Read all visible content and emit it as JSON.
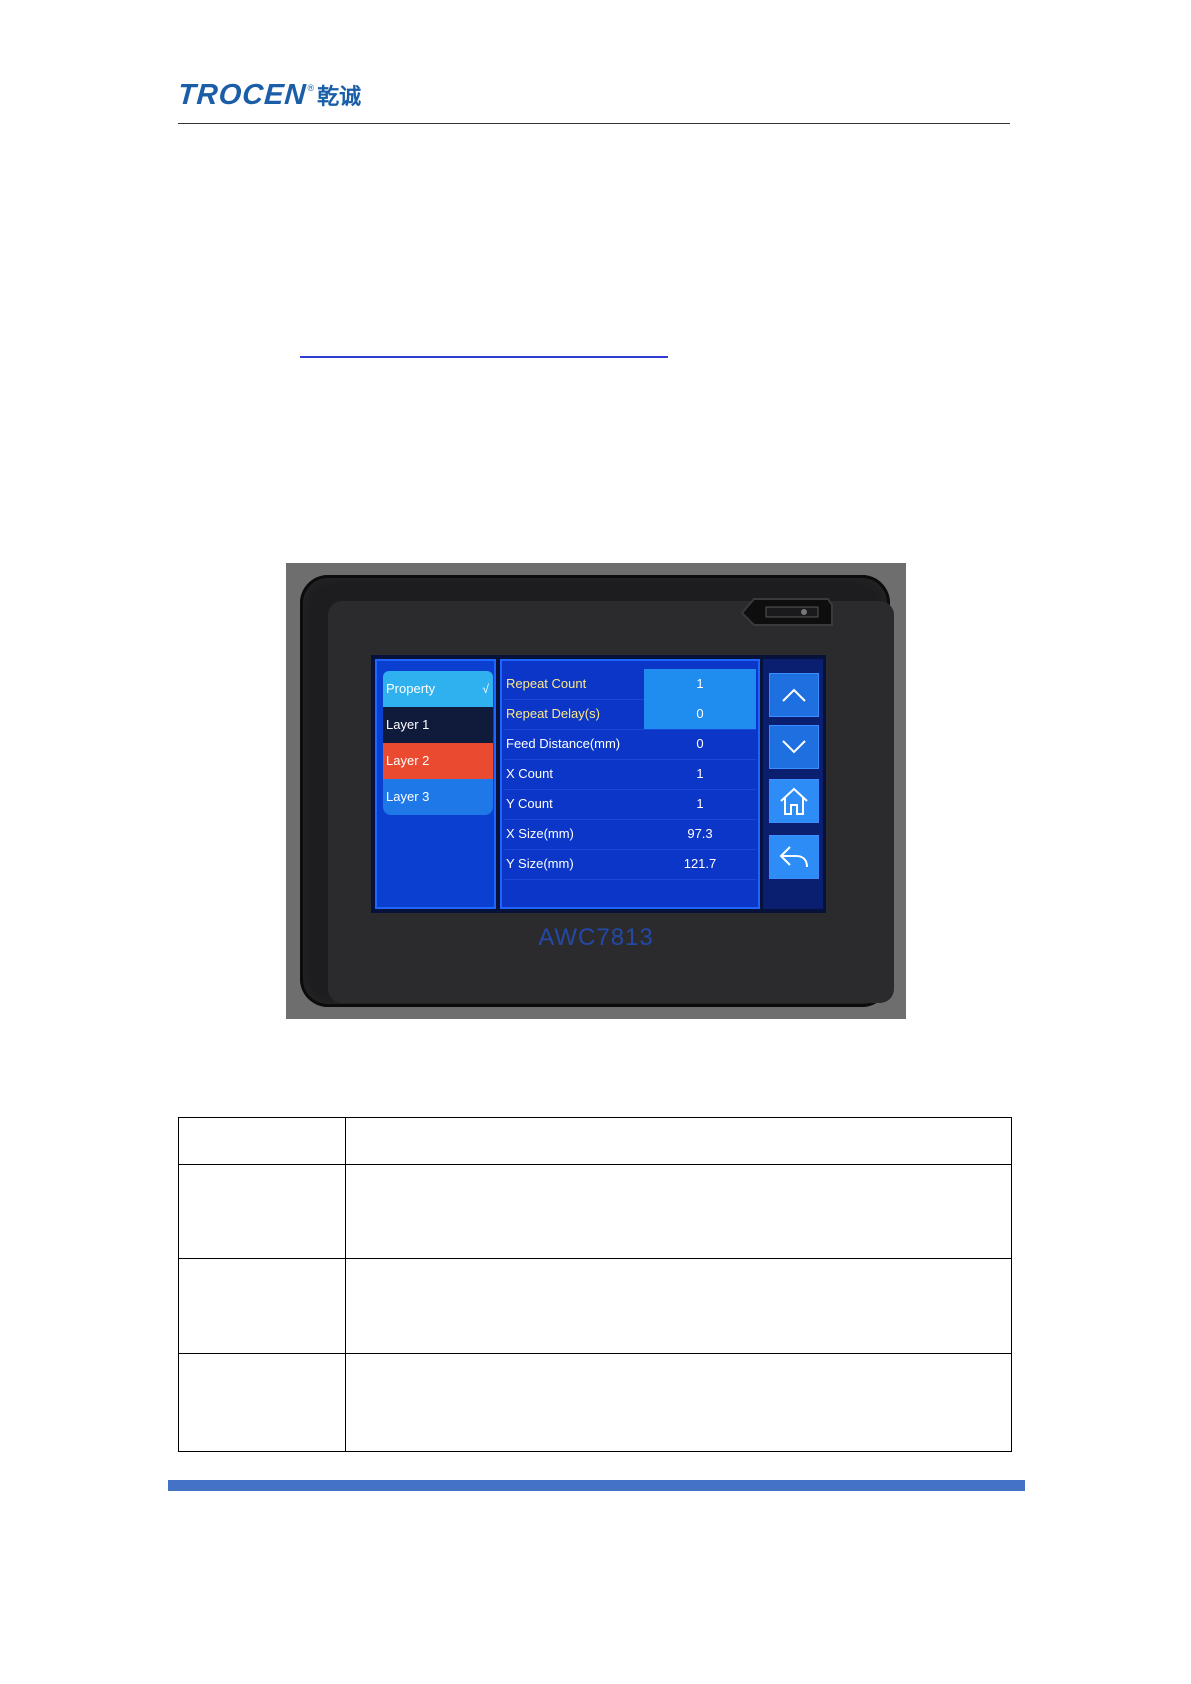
{
  "header": {
    "brand_name": "TROCEN",
    "brand_registered": "®",
    "brand_chinese": "乾诚",
    "brand_color": "#1a5ea8"
  },
  "device": {
    "model": "AWC7813",
    "sidebar": {
      "items": [
        {
          "label": "Property",
          "check": "√",
          "state": "selected"
        },
        {
          "label": "Layer 1",
          "check": "",
          "state": "dark"
        },
        {
          "label": "Layer 2",
          "check": "",
          "state": "red"
        },
        {
          "label": "Layer 3",
          "check": "",
          "state": "normal"
        }
      ]
    },
    "parameters": [
      {
        "label": "Repeat Count",
        "value": "1"
      },
      {
        "label": "Repeat Delay(s)",
        "value": "0"
      },
      {
        "label": "Feed Distance(mm)",
        "value": "0"
      },
      {
        "label": "X Count",
        "value": "1"
      },
      {
        "label": "Y Count",
        "value": "1"
      },
      {
        "label": "X Size(mm)",
        "value": "97.3"
      },
      {
        "label": "Y Size(mm)",
        "value": "121.7"
      }
    ],
    "nav_buttons": [
      {
        "icon": "chevron-up-icon"
      },
      {
        "icon": "chevron-down-icon"
      },
      {
        "icon": "home-icon"
      },
      {
        "icon": "back-arrow-icon"
      }
    ]
  },
  "table": {
    "rows": [
      {
        "name": "",
        "description": ""
      },
      {
        "name": "",
        "description": ""
      },
      {
        "name": "",
        "description": ""
      },
      {
        "name": "",
        "description": ""
      }
    ]
  },
  "colors": {
    "footer_bar": "#4472c4",
    "active_param": "#1f8cf0",
    "layer2": "#ea4a2f"
  }
}
